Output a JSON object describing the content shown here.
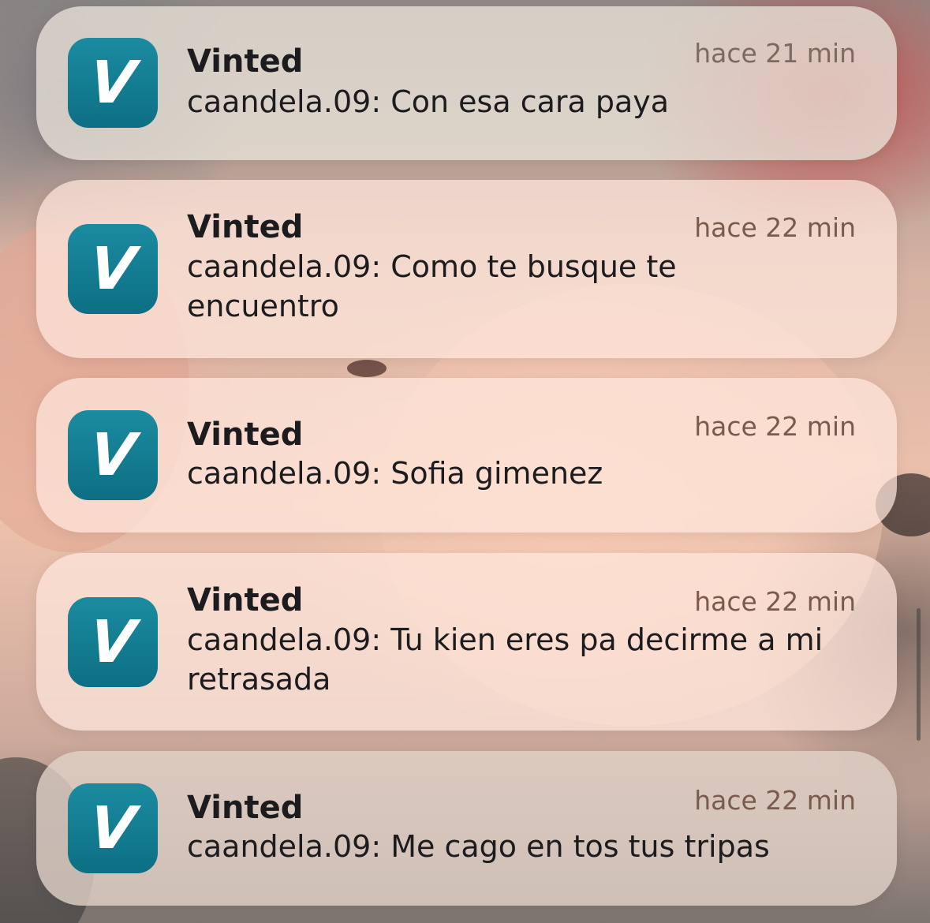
{
  "notifications": [
    {
      "app": "Vinted",
      "time": "hace 21 min",
      "message": "caandela.09: Con esa cara paya"
    },
    {
      "app": "Vinted",
      "time": "hace 22 min",
      "message": "caandela.09: Como te busque te encuentro"
    },
    {
      "app": "Vinted",
      "time": "hace 22 min",
      "message": "caandela.09: Sofia gimenez"
    },
    {
      "app": "Vinted",
      "time": "hace 22 min",
      "message": "caandela.09: Tu kien eres pa decirme a mi retrasada"
    },
    {
      "app": "Vinted",
      "time": "hace 22 min",
      "message": "caandela.09: Me cago en tos tus tripas"
    }
  ],
  "app_icon": {
    "glyph": "V",
    "name": "vinted-icon",
    "color": "#0f7a8f"
  },
  "colors": {
    "card": "#ffe8de",
    "text": "#1c1c1e",
    "time": "#7b5a4e"
  }
}
